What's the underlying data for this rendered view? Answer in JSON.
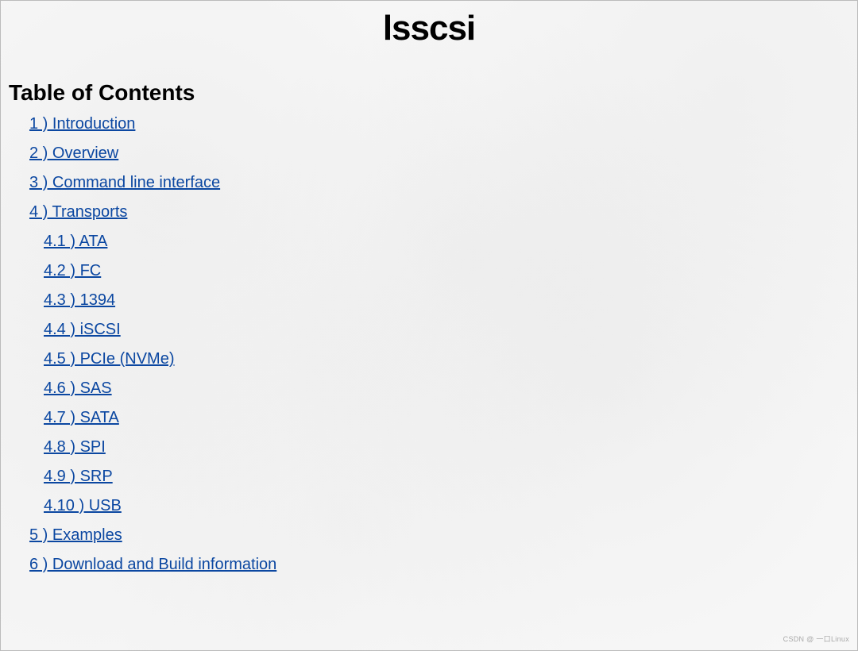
{
  "title": "lsscsi",
  "toc_heading": "Table of Contents",
  "toc": [
    {
      "label": "1 )  Introduction"
    },
    {
      "label": "2 )  Overview"
    },
    {
      "label": "3 )  Command line interface"
    },
    {
      "label": "4 )  Transports",
      "children": [
        {
          "label": "4.1 )  ATA"
        },
        {
          "label": "4.2 )  FC"
        },
        {
          "label": "4.3 )  1394"
        },
        {
          "label": "4.4 )  iSCSI"
        },
        {
          "label": "4.5 )  PCIe (NVMe)"
        },
        {
          "label": "4.6 )  SAS"
        },
        {
          "label": "4.7 )  SATA"
        },
        {
          "label": "4.8 )  SPI"
        },
        {
          "label": "4.9 )  SRP"
        },
        {
          "label": "4.10 )  USB"
        }
      ]
    },
    {
      "label": "5 )  Examples"
    },
    {
      "label": "6 )  Download and Build information"
    }
  ],
  "watermark": "CSDN @ 一口Linux"
}
